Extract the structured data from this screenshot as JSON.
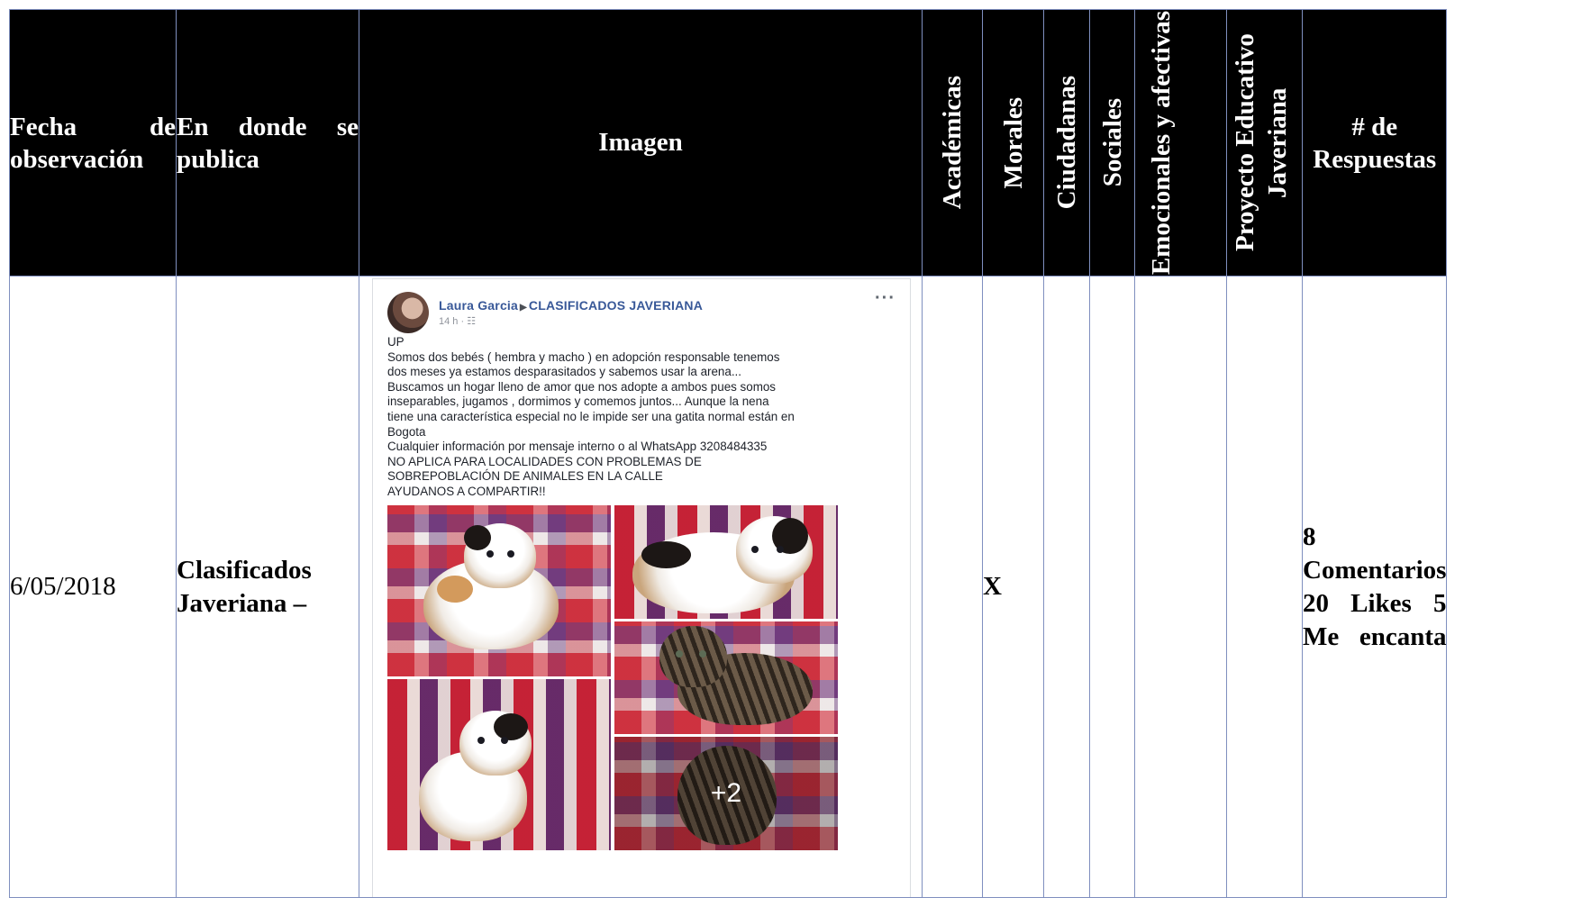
{
  "headers": {
    "fecha": "Fecha de observación",
    "donde": "En donde se publica",
    "imagen": "Imagen",
    "academicas": "Académicas",
    "morales": "Morales",
    "ciudadanas": "Ciudadanas",
    "sociales": "Sociales",
    "emocionales": "Emocionales y afectivas",
    "proyecto": "Proyecto Educativo Javeriana",
    "respuestas": "# de Respuestas"
  },
  "row": {
    "fecha": "6/05/2018",
    "donde": "Clasificados Javeriana –",
    "morales_mark": "X",
    "respuestas": "8 Comentarios 20 Likes 5 Me encanta"
  },
  "post": {
    "author": "Laura Garcia",
    "group": "CLASIFICADOS JAVERIANA",
    "time": "14 h ·",
    "more_icon": "ellipsis-icon",
    "text": "UP\nSomos dos bebés ( hembra y macho ) en adopción responsable tenemos\ndos meses ya estamos desparasitados y sabemos usar la arena...\nBuscamos un hogar lleno de amor que nos adopte a ambos pues somos\ninseparables, jugamos , dormimos y comemos juntos... Aunque la nena\ntiene una característica especial no le impide ser una gatita normal están en\nBogota\nCualquier información por mensaje interno o al WhatsApp 3208484335\nNO APLICA PARA LOCALIDADES CON PROBLEMAS DE\nSOBREPOBLACIÓN DE ANIMALES EN LA CALLE\nAYUDANOS A COMPARTIR!!",
    "more_photos": "+2"
  }
}
